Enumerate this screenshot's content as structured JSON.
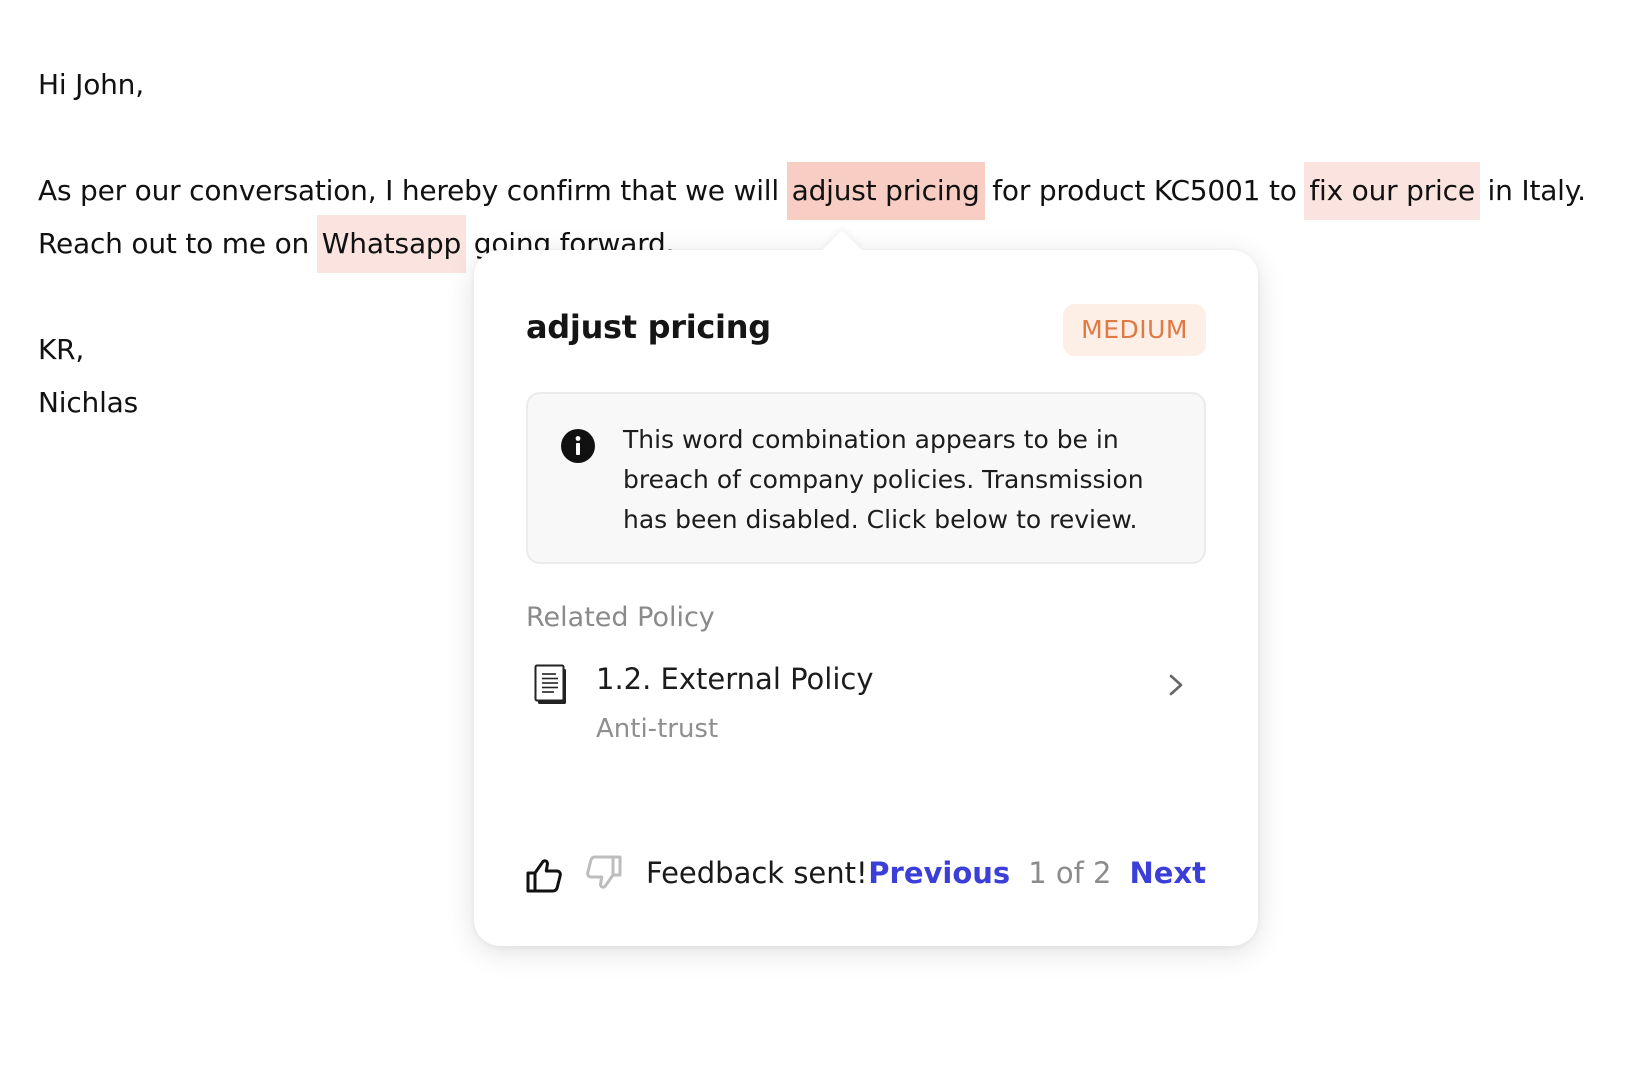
{
  "email": {
    "greeting": "Hi John,",
    "line1": {
      "before": "As per our conversation, I hereby confirm that we will ",
      "flag1": "adjust pricing",
      "middle": " for product KC5001 to ",
      "flag2": "fix our price",
      "after": " in Italy."
    },
    "line2": {
      "before": "Reach out to me on ",
      "flag3": "Whatsapp",
      "after": " going forward."
    },
    "signoff": "KR,",
    "signature": "Nichlas"
  },
  "popover": {
    "title": "adjust pricing",
    "severity": "MEDIUM",
    "message": "This word combination appears to be in breach of company policies. Transmission has been disabled. Click below to review.",
    "info_icon": "info-icon",
    "related_label": "Related Policy",
    "policy": {
      "icon": "document-icon",
      "title": "1.2. External Policy",
      "category": "Anti-trust"
    },
    "feedback": {
      "status": "Feedback sent!",
      "thumbs_up_selected": true
    },
    "pager": {
      "previous_label": "Previous",
      "position": "1 of 2",
      "next_label": "Next"
    }
  },
  "colors": {
    "highlight_strong": "#f7cdc4",
    "highlight_soft": "#fbe4df",
    "severity_text": "#e07a44",
    "severity_bg": "#fdeee6",
    "link": "#3b3fd8"
  }
}
